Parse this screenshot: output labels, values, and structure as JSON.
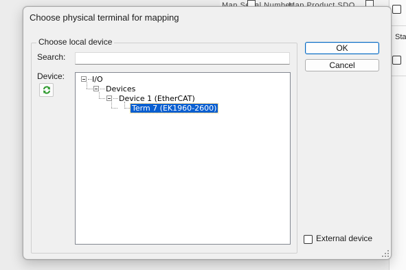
{
  "background": {
    "strip_labels": [
      "Map Serial Number",
      "Map Product SDO"
    ],
    "right_panel_label": "Sta"
  },
  "dialog": {
    "title": "Choose physical terminal for mapping",
    "group_label": "Choose local device",
    "search_label": "Search:",
    "search_value": "",
    "device_label": "Device:",
    "ok_label": "OK",
    "cancel_label": "Cancel",
    "external_device_label": "External device",
    "external_device_checked": false,
    "refresh_icon": "refresh-icon",
    "tree": [
      {
        "label": "I/O",
        "level": 0,
        "expanded": true,
        "selected": false
      },
      {
        "label": "Devices",
        "level": 1,
        "expanded": true,
        "selected": false
      },
      {
        "label": "Device 1 (EtherCAT)",
        "level": 2,
        "expanded": true,
        "selected": false
      },
      {
        "label": "Term 7 (EK1960-2600)",
        "level": 3,
        "expanded": false,
        "selected": true
      }
    ]
  },
  "colors": {
    "selection": "#0a5fd0",
    "default_button_border": "#0067c0"
  }
}
